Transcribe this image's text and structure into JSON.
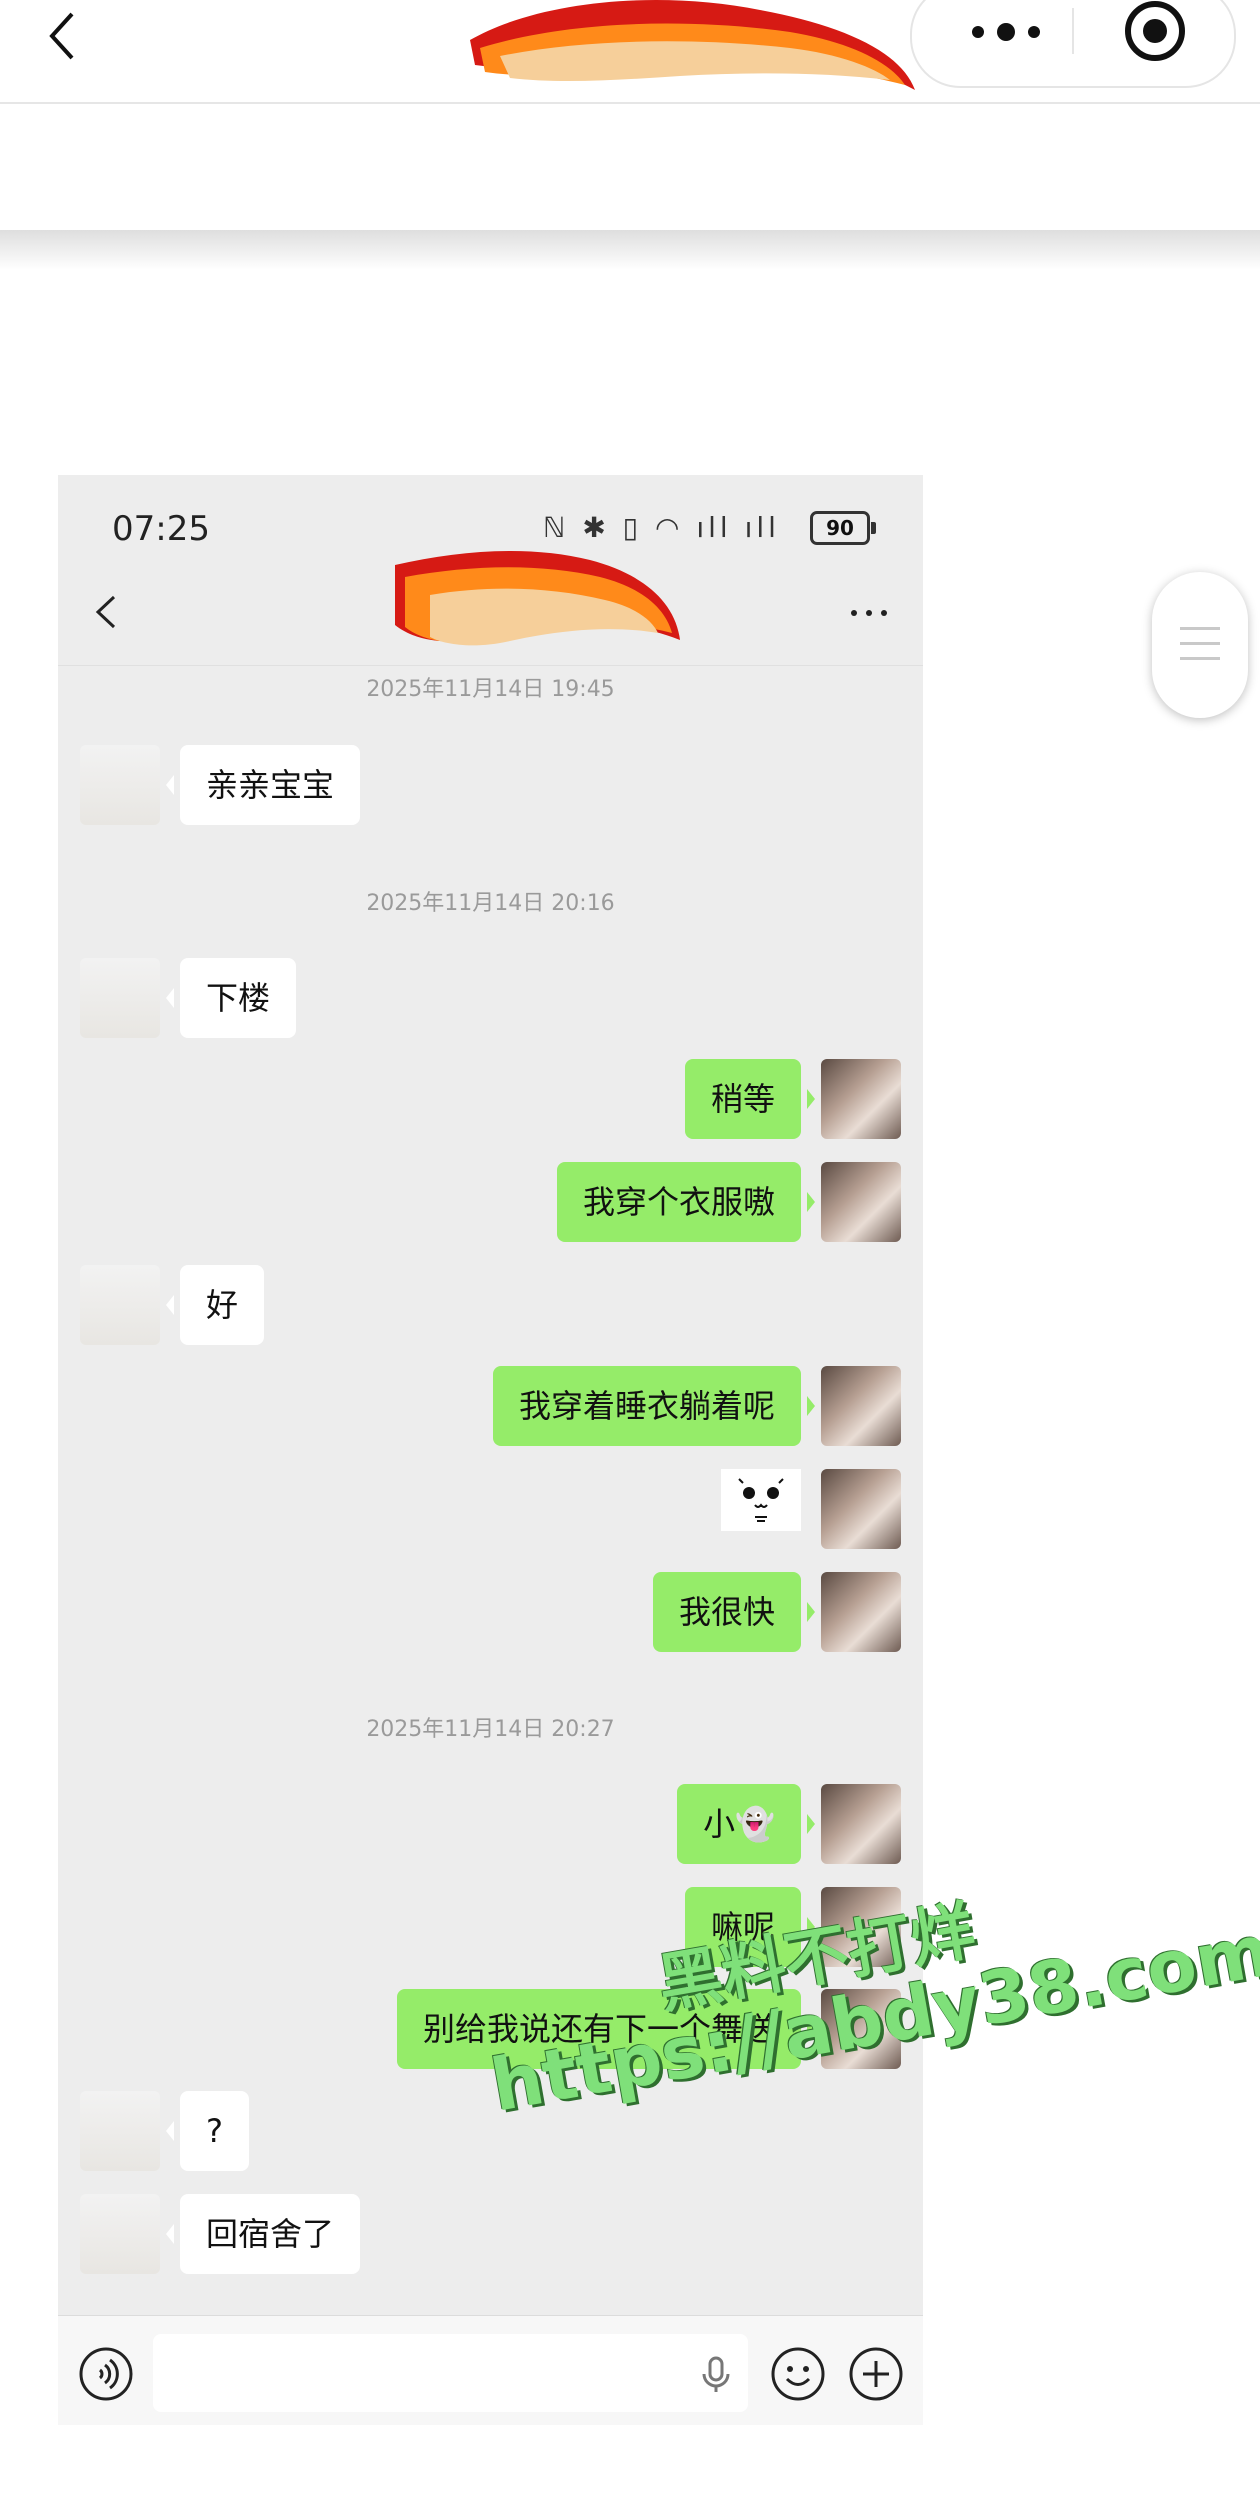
{
  "outer": {
    "title_fragment": "ﾄ"
  },
  "status_bar": {
    "time": "07:25",
    "battery": "90"
  },
  "chat": {
    "timestamps": [
      "2025年11月14日 19:45",
      "2025年11月14日 20:16",
      "2025年11月14日 20:27"
    ],
    "messages": [
      {
        "side": "left",
        "text": "亲亲宝宝"
      },
      {
        "side": "left",
        "text": "下楼"
      },
      {
        "side": "right",
        "text": "稍等"
      },
      {
        "side": "right",
        "text": "我穿个衣服嗷"
      },
      {
        "side": "left",
        "text": "好"
      },
      {
        "side": "right",
        "text": "我穿着睡衣躺着呢"
      },
      {
        "side": "right",
        "type": "sticker"
      },
      {
        "side": "right",
        "text": "我很快"
      },
      {
        "side": "right",
        "text": "小👻"
      },
      {
        "side": "right",
        "text": "嘛呢"
      },
      {
        "side": "right",
        "text": "别给我说还有下一个舞送"
      },
      {
        "side": "left",
        "text": "?"
      },
      {
        "side": "left",
        "text": "回宿舍了"
      }
    ]
  },
  "watermark": {
    "line1": "黑料不打烊",
    "line2": "https://abdy38.com"
  },
  "icons": [
    "back-icon",
    "more-dots-icon",
    "target-icon",
    "voice-icon",
    "mic-icon",
    "emoji-icon",
    "plus-icon"
  ]
}
